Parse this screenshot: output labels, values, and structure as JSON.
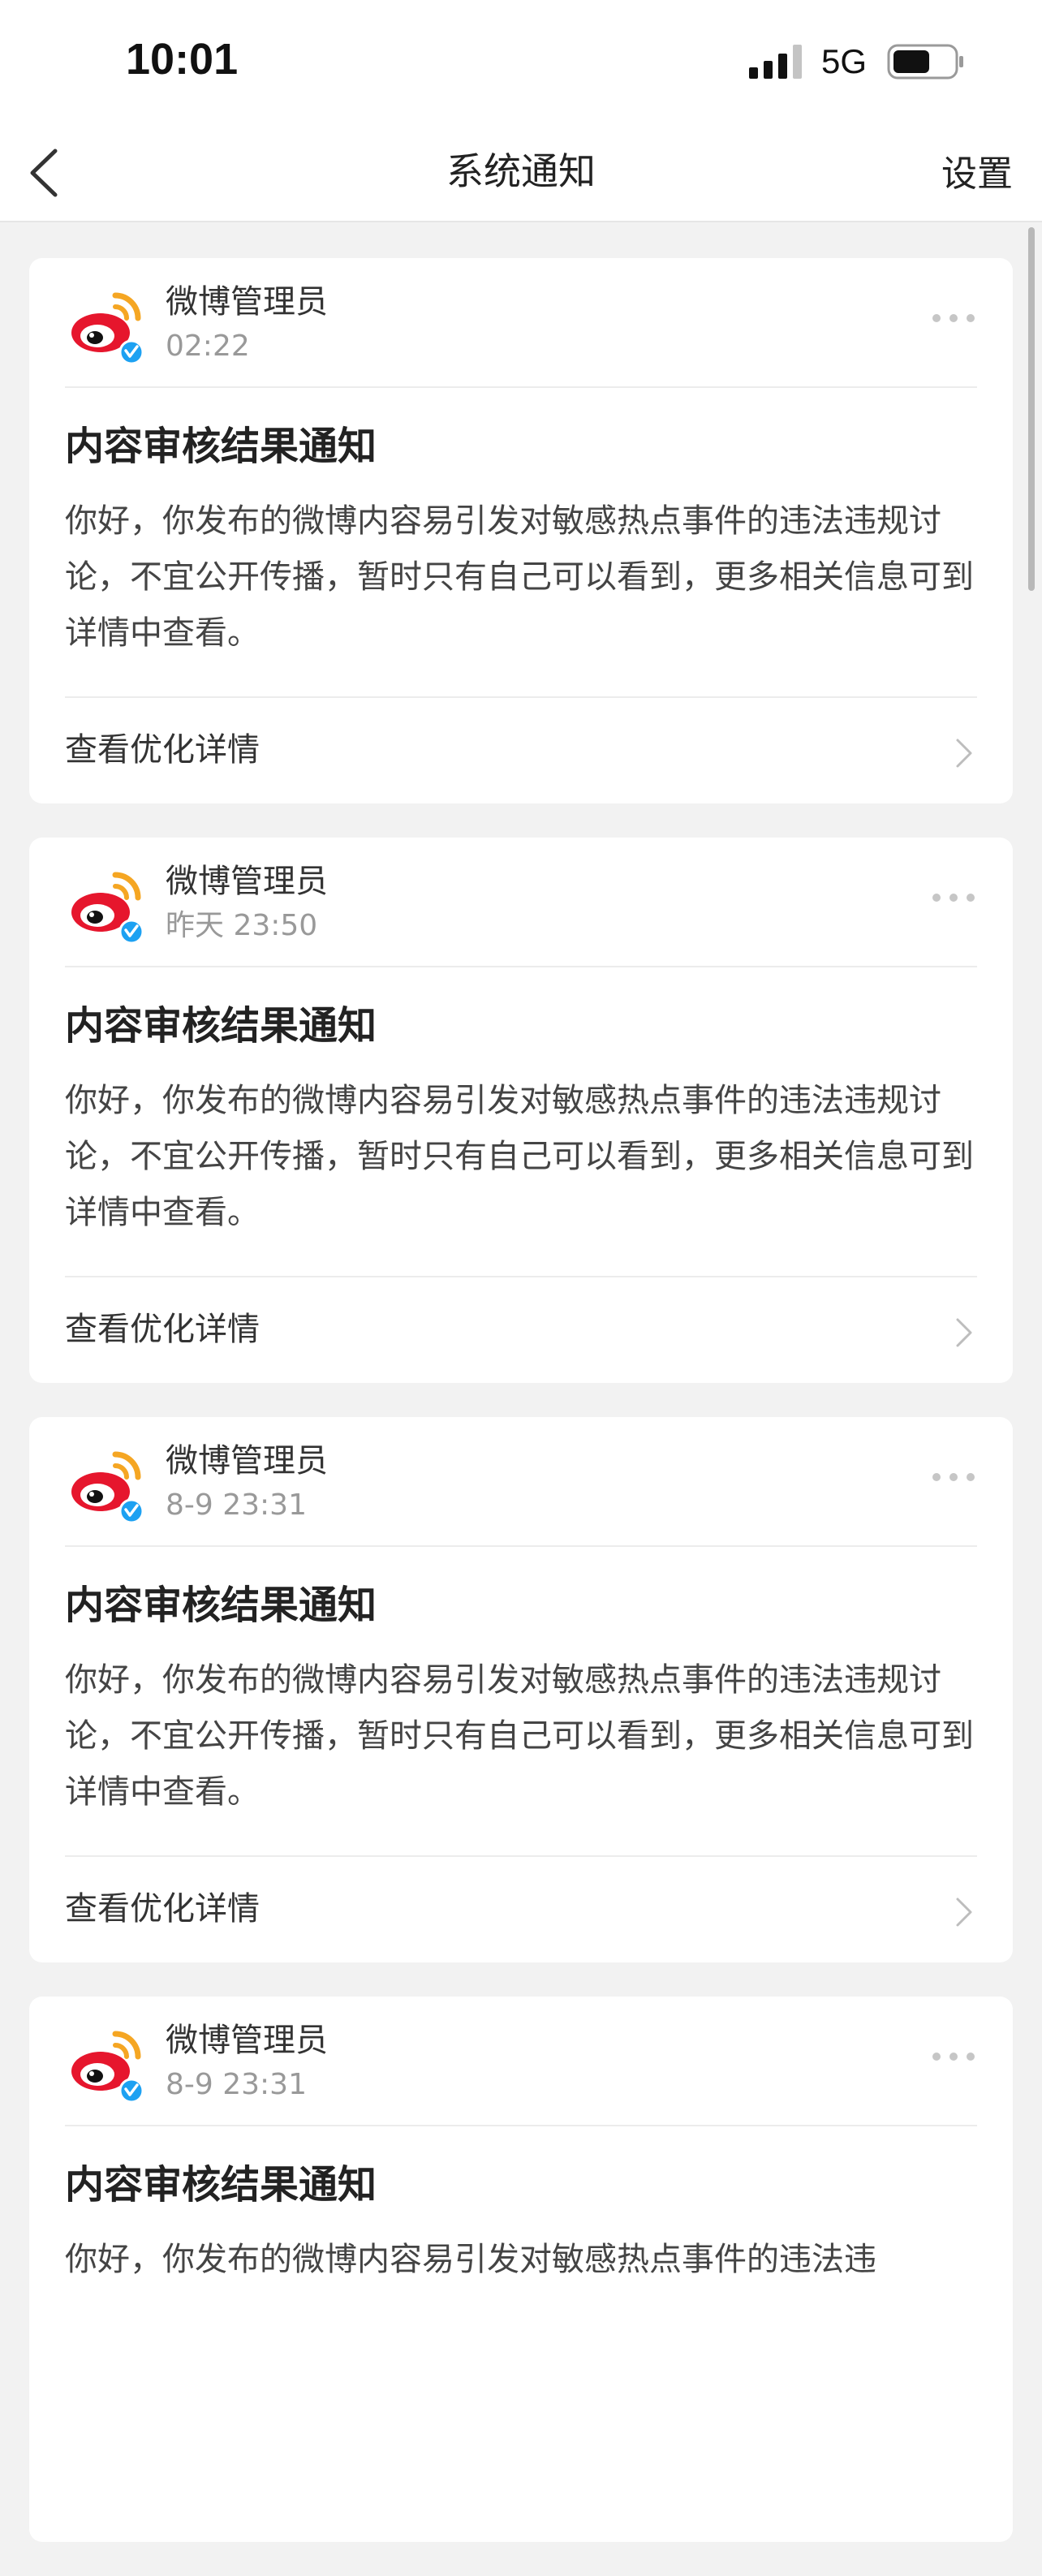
{
  "status_bar": {
    "time": "10:01",
    "network": "5G"
  },
  "nav": {
    "title": "系统通知",
    "settings_label": "设置"
  },
  "icons": {
    "back": "chevron-left-icon",
    "more": "more-dots-icon",
    "detail": "chevron-right-icon",
    "avatar": "weibo-logo-icon",
    "verified": "verified-badge-icon"
  },
  "colors": {
    "weibo_red": "#e6162d",
    "weibo_orange": "#f5a623",
    "verified_blue": "#1da1f2"
  },
  "notifications": [
    {
      "sender": "微博管理员",
      "time": "02:22",
      "title": "内容审核结果通知",
      "body": "你好，你发布的微博内容易引发对敏感热点事件的违法违规讨论，不宜公开传播，暂时只有自己可以看到，更多相关信息可到详情中查看。",
      "link": "查看优化详情"
    },
    {
      "sender": "微博管理员",
      "time": "昨天 23:50",
      "title": "内容审核结果通知",
      "body": "你好，你发布的微博内容易引发对敏感热点事件的违法违规讨论，不宜公开传播，暂时只有自己可以看到，更多相关信息可到详情中查看。",
      "link": "查看优化详情"
    },
    {
      "sender": "微博管理员",
      "time": "8-9 23:31",
      "title": "内容审核结果通知",
      "body": "你好，你发布的微博内容易引发对敏感热点事件的违法违规讨论，不宜公开传播，暂时只有自己可以看到，更多相关信息可到详情中查看。",
      "link": "查看优化详情"
    },
    {
      "sender": "微博管理员",
      "time": "8-9 23:31",
      "title": "内容审核结果通知",
      "body": "你好，你发布的微博内容易引发对敏感热点事件的违法违",
      "link": ""
    }
  ]
}
